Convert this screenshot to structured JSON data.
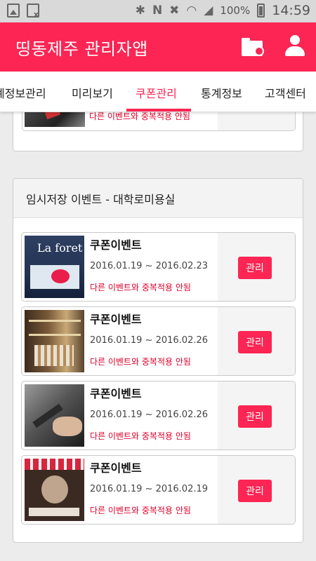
{
  "status_bar": {
    "battery": "100%",
    "time": "14:59"
  },
  "app_bar": {
    "title": "띵동제주 관리자앱"
  },
  "tabs": [
    {
      "label": "계정보관리"
    },
    {
      "label": "미리보기"
    },
    {
      "label": "쿠폰관리",
      "active": true
    },
    {
      "label": "통계정보"
    },
    {
      "label": "고객센터"
    }
  ],
  "partial_card": {
    "note": "다른 이벤트와 중복적용 안됨"
  },
  "panel": {
    "title": "임시저장 이벤트 - 대학로미용실",
    "items": [
      {
        "title": "쿠폰이벤트",
        "date": "2016.01.19 ~ 2016.02.23",
        "note": "다른 이벤트와 중복적용 안됨",
        "button": "관리",
        "thumb_text": "La foret"
      },
      {
        "title": "쿠폰이벤트",
        "date": "2016.01.19 ~ 2016.02.26",
        "note": "다른 이벤트와 중복적용 안됨",
        "button": "관리"
      },
      {
        "title": "쿠폰이벤트",
        "date": "2016.01.19 ~ 2016.02.26",
        "note": "다른 이벤트와 중복적용 안됨",
        "button": "관리"
      },
      {
        "title": "쿠폰이벤트",
        "date": "2016.01.19 ~ 2016.02.19",
        "note": "다른 이벤트와 중복적용 안됨",
        "button": "관리"
      }
    ]
  },
  "colors": {
    "accent": "#fc2553",
    "note_red": "#e0002a",
    "status_bar": "#d9d9d9",
    "background": "#ececec"
  }
}
